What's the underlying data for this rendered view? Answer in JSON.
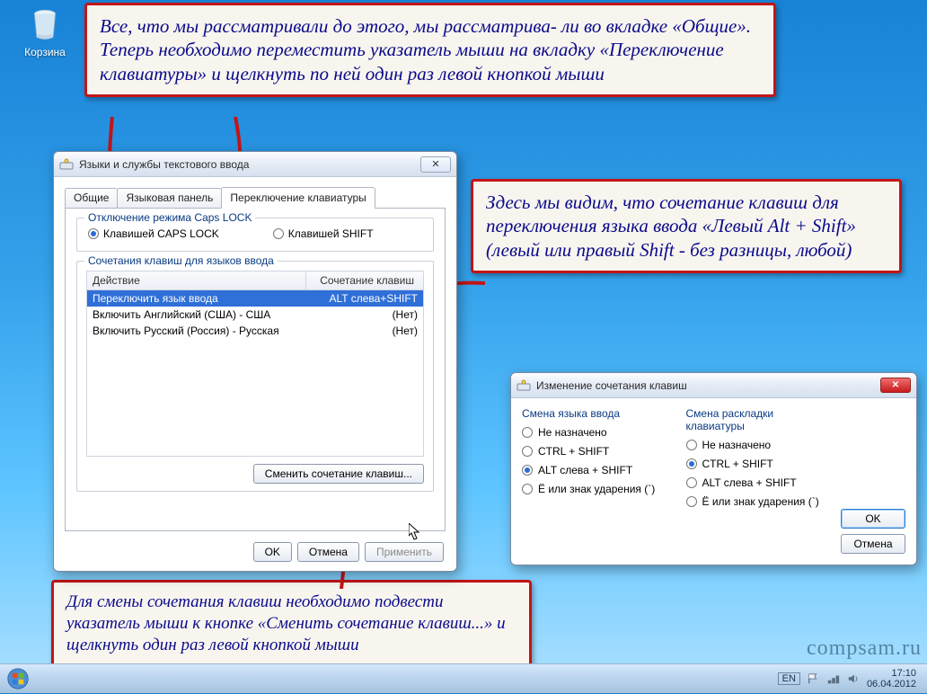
{
  "desktop": {
    "recycle_label": "Корзина"
  },
  "callouts": {
    "c1": "Все, что мы рассматривали до этого, мы рассматрива-\nли во вкладке «Общие». Теперь необходимо переместить указатель мыши на вкладку «Переключение клавиатуры» и щелкнуть по ней один раз левой кнопкой мыши",
    "c2": "Здесь мы видим, что сочетание клавиш для переключения языка ввода «Левый Alt + Shift» (левый или правый Shift - без разницы, любой)",
    "c3": "Для смены сочетания клавиш необходимо подвести указатель мыши к кнопке «Сменить сочетание клавиш...» и щелкнуть один раз левой кнопкой мыши"
  },
  "dialog1": {
    "title": "Языки и службы текстового ввода",
    "tabs": {
      "general": "Общие",
      "langbar": "Языковая панель",
      "switch": "Переключение клавиатуры"
    },
    "capslock": {
      "group_title": "Отключение режима Caps LOCK",
      "opt1": "Клавишей CAPS LOCK",
      "opt2": "Клавишей SHIFT"
    },
    "hotkeys": {
      "group_title": "Сочетания клавиш для языков ввода",
      "col_action": "Действие",
      "col_keys": "Сочетание клавиш",
      "rows": [
        {
          "action": "Переключить язык ввода",
          "keys": "ALT слева+SHIFT"
        },
        {
          "action": "Включить Английский (США) - США",
          "keys": "(Нет)"
        },
        {
          "action": "Включить Русский (Россия) - Русская",
          "keys": "(Нет)"
        }
      ],
      "change_btn": "Сменить сочетание клавиш..."
    },
    "footer": {
      "ok": "OK",
      "cancel": "Отмена",
      "apply": "Применить"
    }
  },
  "dialog2": {
    "title": "Изменение сочетания клавиш",
    "left_title": "Смена языка ввода",
    "right_title": "Смена раскладки клавиатуры",
    "opts": {
      "none": "Не назначено",
      "ctrlshift": "CTRL + SHIFT",
      "altshift": "ALT слева + SHIFT",
      "grave": "Ё или знак ударения (`)"
    },
    "ok": "OK",
    "cancel": "Отмена"
  },
  "taskbar": {
    "lang": "EN",
    "time": "17:10",
    "date": "06.04.2012"
  },
  "watermark": "compsam.ru"
}
